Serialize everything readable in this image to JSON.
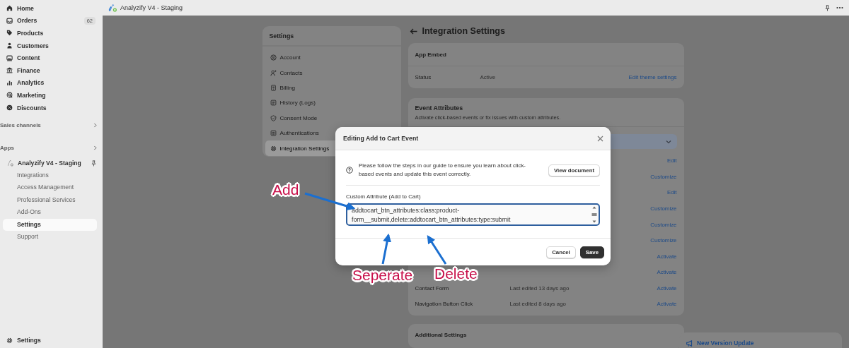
{
  "top_bar": {
    "app_title": "Analyzify V4 - Staging"
  },
  "sidebar": {
    "nav_items": [
      {
        "label": "Home"
      },
      {
        "label": "Orders",
        "badge": "62"
      },
      {
        "label": "Products"
      },
      {
        "label": "Customers"
      },
      {
        "label": "Content"
      },
      {
        "label": "Finance"
      },
      {
        "label": "Analytics"
      },
      {
        "label": "Marketing"
      },
      {
        "label": "Discounts"
      }
    ],
    "sections": [
      {
        "label": "Sales channels"
      },
      {
        "label": "Apps"
      }
    ],
    "app": {
      "label": "Analyzify V4 - Staging",
      "sub_items": [
        {
          "label": "Integrations",
          "selected": false
        },
        {
          "label": "Access Management",
          "selected": false
        },
        {
          "label": "Professional Services",
          "selected": false
        },
        {
          "label": "Add-Ons",
          "selected": false
        },
        {
          "label": "Settings",
          "selected": true
        },
        {
          "label": "Support",
          "selected": false
        }
      ]
    },
    "footer_item": "Settings"
  },
  "settings_nav": {
    "title": "Settings",
    "items": [
      {
        "label": "Account",
        "selected": false
      },
      {
        "label": "Contacts",
        "selected": false
      },
      {
        "label": "Billing",
        "selected": false
      },
      {
        "label": "History (Logs)",
        "selected": false
      },
      {
        "label": "Consent Mode",
        "selected": false
      },
      {
        "label": "Authentications",
        "selected": false
      },
      {
        "label": "Integration Settings",
        "selected": true
      }
    ]
  },
  "page": {
    "title": "Integration Settings",
    "app_embed": {
      "title": "App Embed",
      "status_label": "Status",
      "status_value": "Active",
      "action": "Edit theme settings"
    },
    "event_attributes": {
      "title": "Event Attributes",
      "subtitle": "Activate click-based events or fix issues with custom attributes.",
      "rows": [
        {
          "action": "Edit"
        },
        {
          "action": "Customize"
        },
        {
          "action": "Edit"
        },
        {
          "action": "Customize"
        },
        {
          "action": "Customize"
        },
        {
          "action": "Customize"
        },
        {
          "action": "Activate"
        },
        {
          "action": "Activate"
        },
        {
          "name": "Contact Form",
          "edited": "Last edited 13 days ago",
          "action": "Activate"
        },
        {
          "name": "Navigation Button Click",
          "edited": "Last edited 8 days ago",
          "action": "Activate"
        }
      ]
    },
    "additional_settings": {
      "title": "Additional Settings"
    }
  },
  "update_card": {
    "title": "New Version Update"
  },
  "modal": {
    "title": "Editing Add to Cart Event",
    "info": "Please follow the steps in our guide to ensure you learn about click-based events and update this event correctly.",
    "doc_button": "View document",
    "field_label": "Custom Attribute (Add to Cart)",
    "field_value": "addtocart_btn_attributes:class:product-form__submit,delete:addtocart_btn_attributes:type:submit",
    "cancel": "Cancel",
    "save": "Save"
  },
  "annotations": [
    {
      "label": "Add"
    },
    {
      "label": "Seperate"
    },
    {
      "label": "Delete"
    }
  ]
}
